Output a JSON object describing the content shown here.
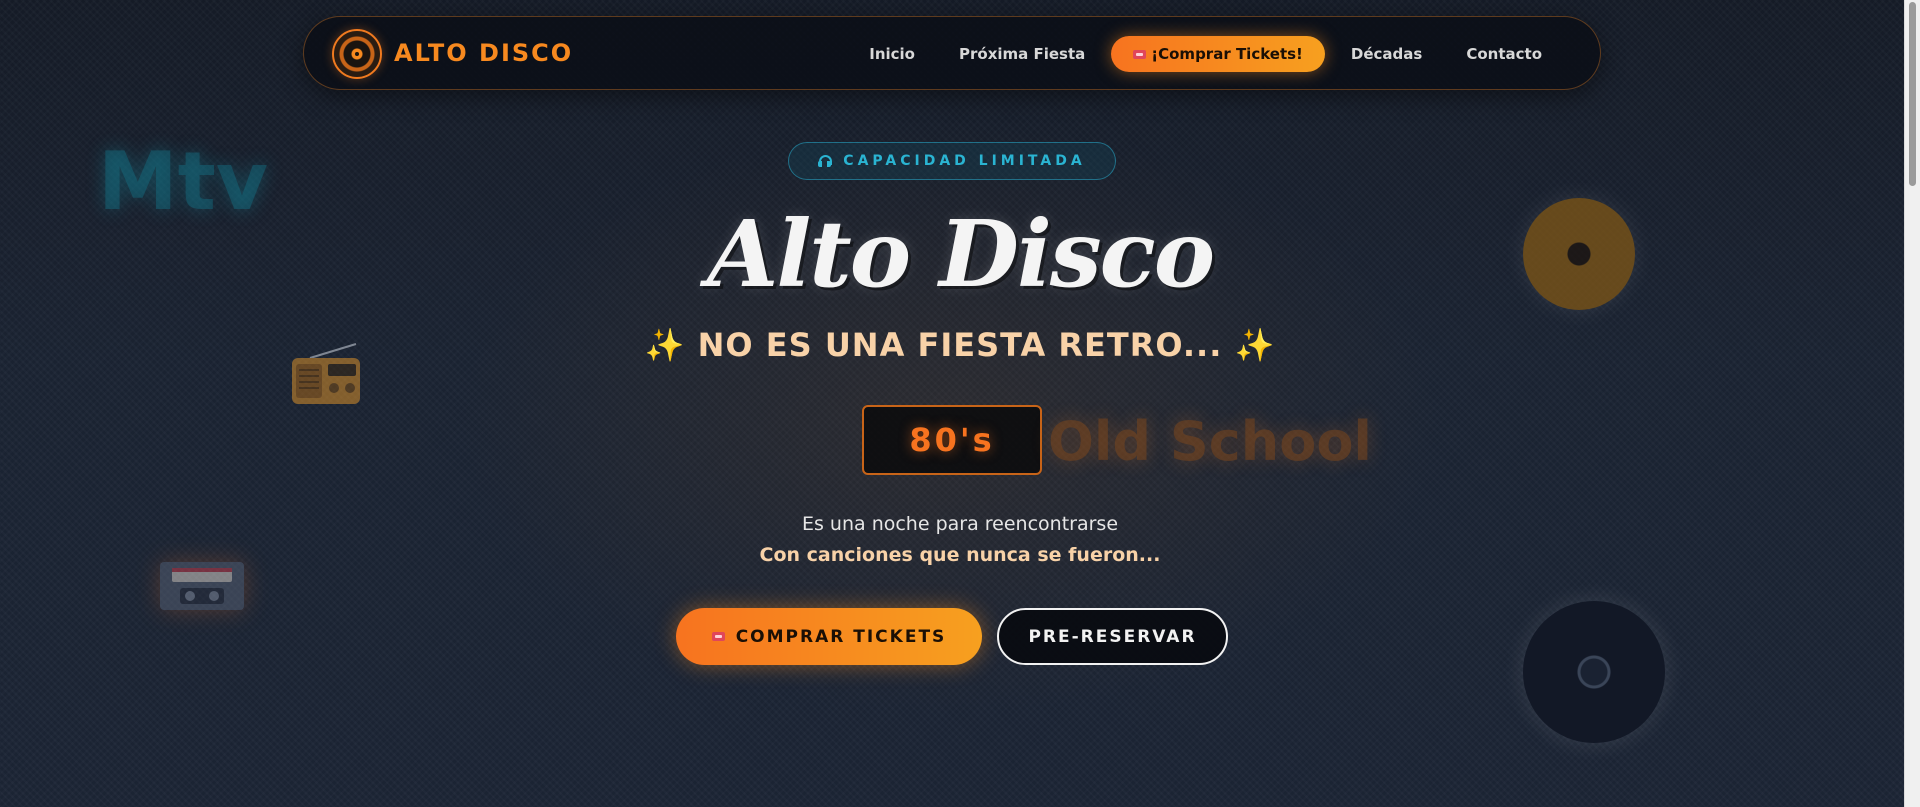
{
  "nav": {
    "brand": "ALTO DISCO",
    "links": [
      "Inicio",
      "Próxima Fiesta",
      "Décadas",
      "Contacto"
    ],
    "cta": {
      "icon": "ticket-icon",
      "label": "¡Comprar Tickets!"
    }
  },
  "decorations": {
    "mtv_text": "Mtv",
    "icons": [
      "radio-icon",
      "vhs-tape-icon",
      "vinyl-record-icon"
    ]
  },
  "hero": {
    "badge": {
      "icon": "headphones-icon",
      "label": "CAPACIDAD LIMITADA"
    },
    "title": "Alto Disco",
    "tagline": {
      "spark": "✨",
      "text": "NO ES UNA FIESTA RETRO..."
    },
    "decade_current": "80's",
    "decade_next": "Old School",
    "intro": "Es una noche para reencontrarse",
    "intro_strong": "Con canciones que nunca se fueron...",
    "buttons": {
      "primary": {
        "icon": "ticket-icon",
        "label": "COMPRAR TICKETS"
      },
      "secondary": {
        "label": "PRE-RESERVAR"
      }
    }
  },
  "colors": {
    "accent": "#f7891f",
    "accent_gradient_end": "#f7a01f",
    "badge_cyan": "#2ab4d2",
    "cream": "#f8d2a8",
    "background": "#1a2230"
  }
}
